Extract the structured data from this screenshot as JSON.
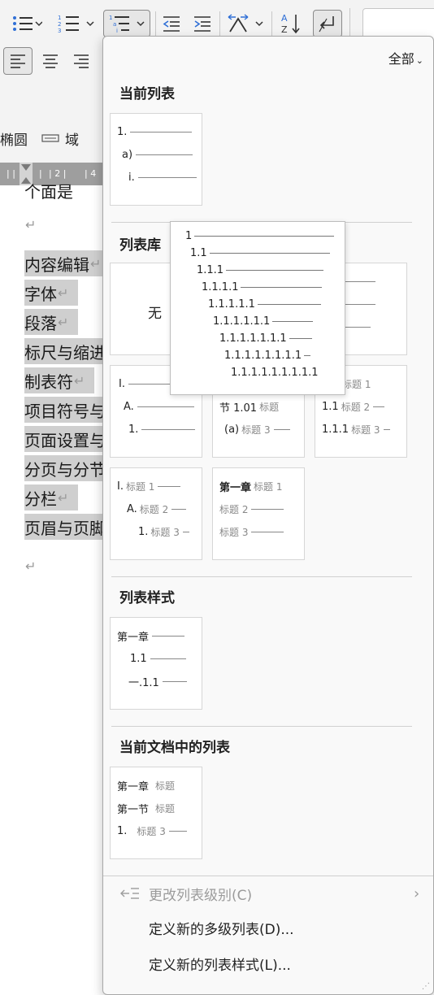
{
  "ribbon": {
    "bullet_icon": "bullet-list-icon",
    "numbered_icon": "numbered-list-icon",
    "multilevel_icon": "multilevel-list-icon",
    "decrease_indent_icon": "decrease-indent-icon",
    "increase_indent_icon": "increase-indent-icon",
    "spacing_icon": "character-spacing-icon",
    "sort_icon": "sort-icon",
    "show_marks_icon": "show-marks-icon",
    "align_left_icon": "align-left-icon",
    "align_center_icon": "align-center-icon",
    "align_right_icon": "align-right-icon",
    "field_label_prefix": "椭圆",
    "field_label": "域",
    "ruler_marks": [
      "1",
      "2",
      "4"
    ]
  },
  "document": {
    "top_fragment": "个面是",
    "lines": [
      "内容编辑",
      "字体",
      "段落",
      "标尺与缩进",
      "制表符",
      "项目符号与",
      "页面设置与",
      "分页与分节",
      "分栏",
      "页眉与页脚"
    ]
  },
  "panel": {
    "filter_label": "全部",
    "current_list_title": "当前列表",
    "current_list_levels": [
      "1.",
      "a)",
      "i."
    ],
    "library_title": "列表库",
    "none_label": "无",
    "library_thumb3_levels": [
      "1."
    ],
    "roman_levels": [
      "I.",
      "A.",
      "1."
    ],
    "section_levels": [
      "节 1.01",
      "(a)"
    ],
    "section_labels": [
      "标题",
      "标题 3"
    ],
    "decimal_heading_levels": [
      "1",
      "1.1",
      "1.1.1"
    ],
    "decimal_heading_labels": [
      "标题 1",
      "标题 2",
      "标题 3"
    ],
    "roman_heading_levels": [
      "I.",
      "A.",
      "1."
    ],
    "roman_heading_labels": [
      "标题 1",
      "标题 2",
      "标题 3"
    ],
    "chapter_levels": [
      "第一章"
    ],
    "chapter_labels": [
      "标题 1",
      "标题 2",
      "标题 3"
    ],
    "list_style_title": "列表样式",
    "list_style_levels": [
      "第一章",
      "1.1",
      "一.1.1"
    ],
    "doc_lists_title": "当前文档中的列表",
    "doc_list_levels": [
      "第一章",
      "第一节",
      "1."
    ],
    "doc_list_labels": [
      "标题",
      "标题",
      "标题 3"
    ],
    "menu_change_level": "更改列表级别(C)",
    "menu_define_multilevel": "定义新的多级列表(D)...",
    "menu_define_style": "定义新的列表样式(L)..."
  },
  "preview": {
    "levels": [
      "1",
      "1.1",
      "1.1.1",
      "1.1.1.1",
      "1.1.1.1.1",
      "1.1.1.1.1.1",
      "1.1.1.1.1.1.1",
      "1.1.1.1.1.1.1.1",
      "1.1.1.1.1.1.1.1.1"
    ]
  }
}
